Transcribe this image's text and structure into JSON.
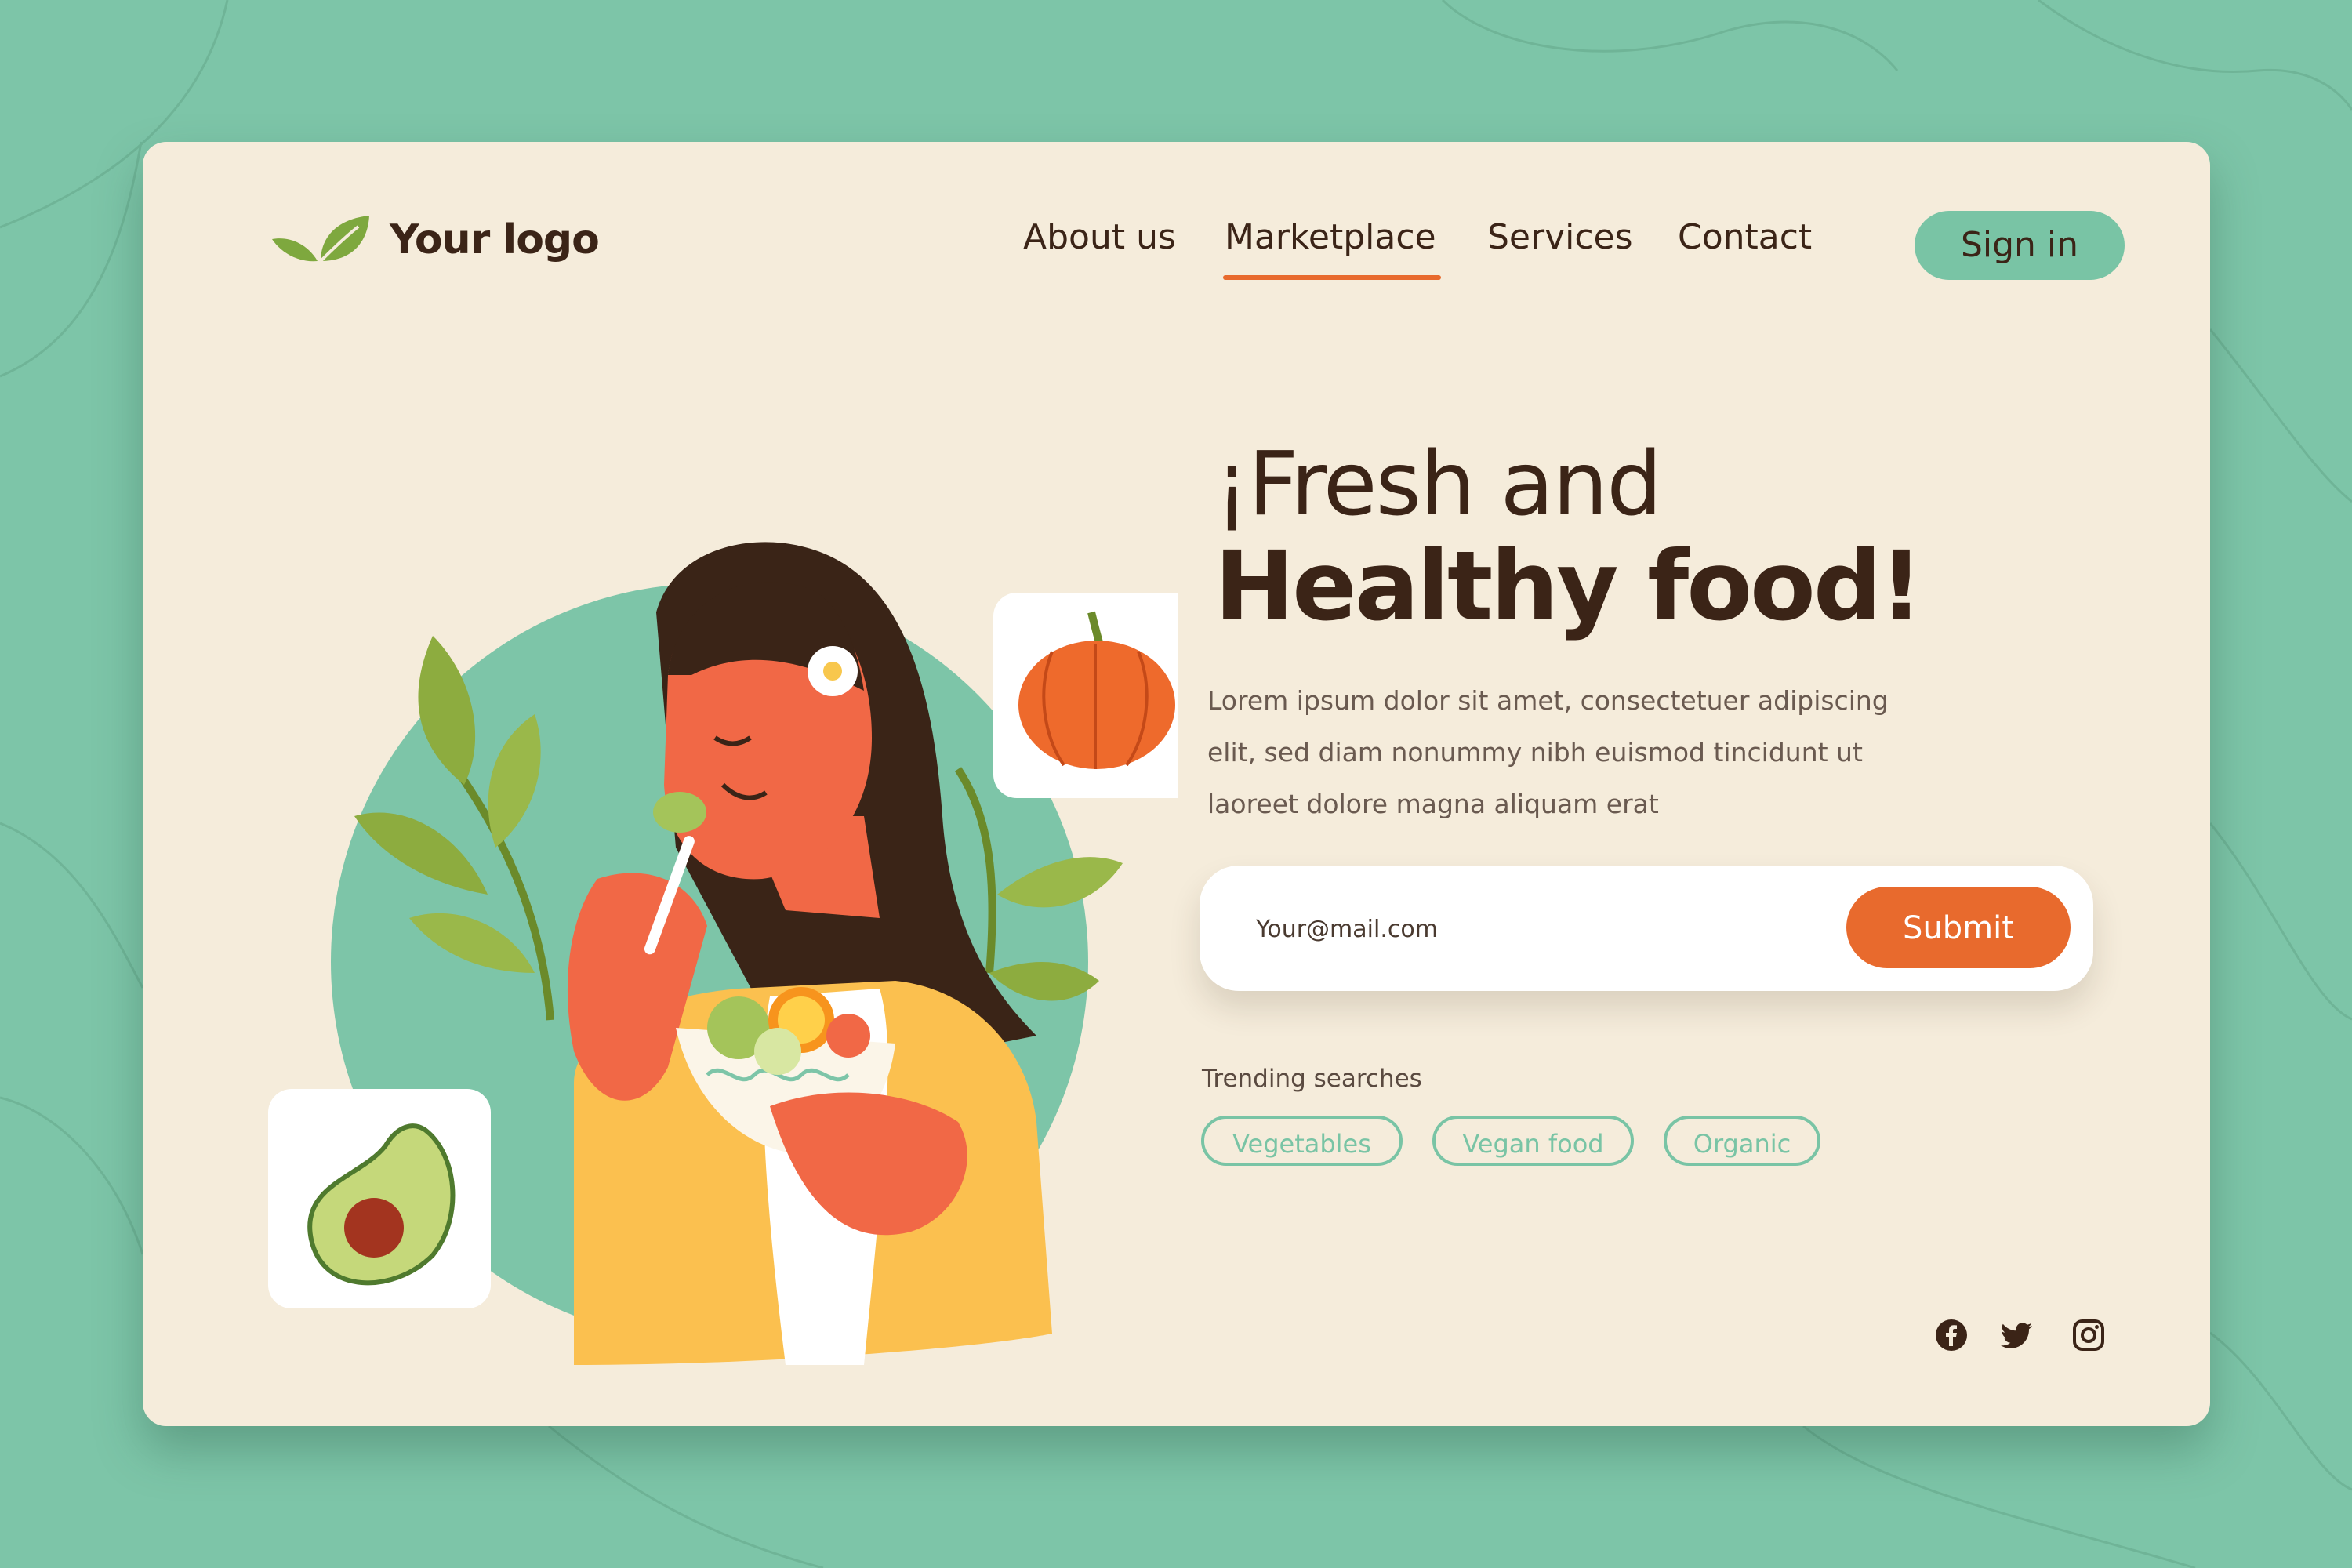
{
  "brand": {
    "logo_text": "Your logo",
    "logo_icon": "leaf-icon"
  },
  "nav": {
    "items": [
      {
        "label": "About us",
        "active": false
      },
      {
        "label": "Marketplace",
        "active": true
      },
      {
        "label": "Services",
        "active": false
      },
      {
        "label": "Contact",
        "active": false
      }
    ],
    "signin_label": "Sign in"
  },
  "hero": {
    "title_line1": "¡Fresh and",
    "title_line2": "Healthy food!",
    "description": "Lorem ipsum dolor sit amet, consectetuer adipiscing elit, sed diam nonummy nibh euismod tincidunt ut laoreet dolore magna aliquam erat"
  },
  "newsletter": {
    "placeholder": "Your@mail.com",
    "submit_label": "Submit"
  },
  "trending": {
    "label": "Trending searches",
    "tags": [
      "Vegetables",
      "Vegan food",
      "Organic"
    ]
  },
  "social": {
    "icons": [
      "facebook-icon",
      "twitter-icon",
      "instagram-icon"
    ]
  },
  "colors": {
    "background": "#7dc5a8",
    "card": "#f5ecdb",
    "text_dark": "#3b2417",
    "accent_orange": "#e86a2d",
    "accent_green": "#79c4a5"
  }
}
